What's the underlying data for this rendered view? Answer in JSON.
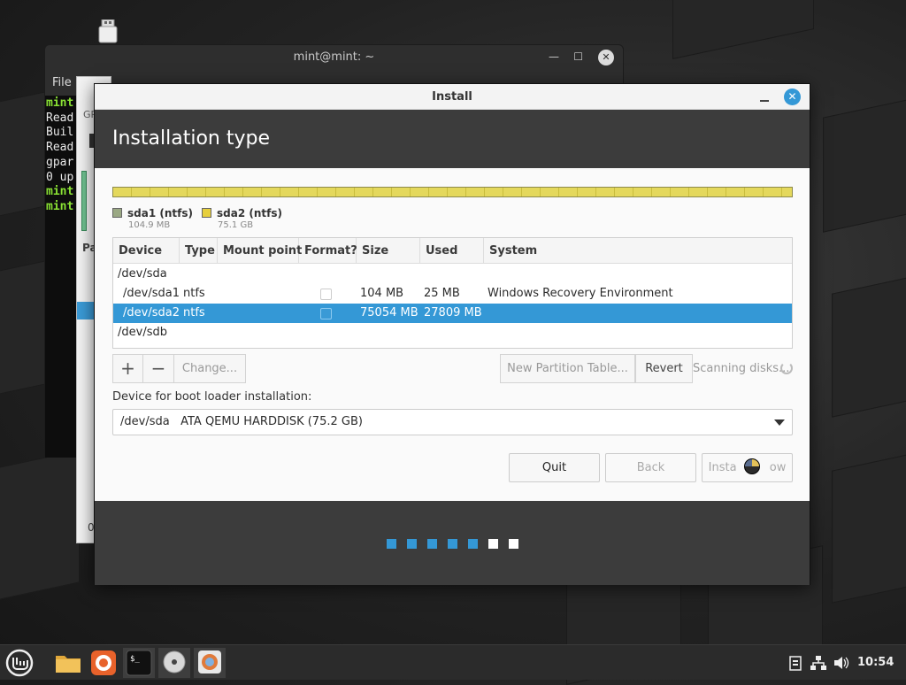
{
  "terminal": {
    "title": "mint@mint: ~",
    "menu": "File",
    "lines": [
      "mint",
      "Read",
      "Buil",
      "Read",
      "gpar",
      "0 up",
      "mint",
      "mint"
    ]
  },
  "gparted": {
    "label_gp": "GP",
    "label_pa": "Pa",
    "label_0": "0"
  },
  "installer": {
    "window_title": "Install",
    "heading": "Installation type",
    "legend": [
      {
        "name": "sda1 (ntfs)",
        "size": "104.9 MB",
        "color": "#9aa884"
      },
      {
        "name": "sda2 (ntfs)",
        "size": "75.1 GB",
        "color": "#e6cf3d"
      }
    ],
    "columns": [
      "Device",
      "Type",
      "Mount point",
      "Format?",
      "Size",
      "Used",
      "System"
    ],
    "rows": [
      {
        "device": "/dev/sda",
        "type": "",
        "mount": "",
        "size": "",
        "used": "",
        "system": ""
      },
      {
        "device": "/dev/sda1",
        "type": "ntfs",
        "mount": "",
        "size": "104 MB",
        "used": "25 MB",
        "system": "Windows Recovery Environment"
      },
      {
        "device": "/dev/sda2",
        "type": "ntfs",
        "mount": "",
        "size": "75054 MB",
        "used": "27809 MB",
        "system": "",
        "selected": true
      },
      {
        "device": "/dev/sdb",
        "type": "",
        "mount": "",
        "size": "",
        "used": "",
        "system": ""
      }
    ],
    "toolbar": {
      "add": "+",
      "remove": "−",
      "change": "Change...",
      "new_table": "New Partition Table...",
      "revert": "Revert",
      "status": "Scanning disks..."
    },
    "bootloader": {
      "label": "Device for boot loader installation:",
      "device": "/dev/sda",
      "description": "ATA QEMU HARDDISK (75.2 GB)"
    },
    "buttons": {
      "quit": "Quit",
      "back": "Back",
      "install": "Install Now",
      "install_visible": "Insta         ow"
    },
    "progress": {
      "total_steps": 7,
      "completed_steps": 5,
      "active_color": "#3498d6",
      "pending_color": "#ffffff"
    }
  },
  "taskbar": {
    "clock": "10:54",
    "icons": [
      "mint-menu-icon",
      "files-icon",
      "firefox-icon",
      "terminal-icon",
      "installer-disc-icon",
      "gparted-icon"
    ],
    "tray": [
      "clipboard-icon",
      "network-icon",
      "volume-icon"
    ]
  }
}
